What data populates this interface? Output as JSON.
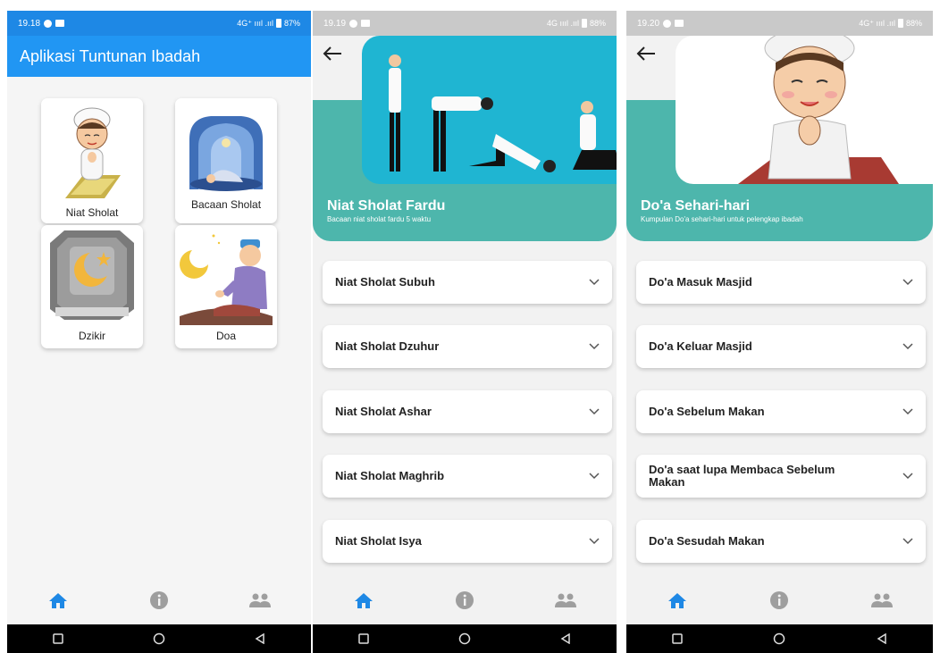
{
  "colors": {
    "primary": "#2196f3",
    "teal": "#4db6ac",
    "nav_active": "#1e88e5",
    "nav_inactive": "#9e9e9e"
  },
  "screen1": {
    "status": {
      "time": "19.18",
      "signal": "4G⁺ ıııl .ııl",
      "battery": "87%"
    },
    "appbar_title": "Aplikasi Tuntunan Ibadah",
    "cards": [
      {
        "label": "Niat Sholat",
        "icon": "praying-boy-icon"
      },
      {
        "label": "Bacaan Sholat",
        "icon": "mosque-prostration-icon"
      },
      {
        "label": "Dzikir",
        "icon": "crescent-star-icon"
      },
      {
        "label": "Doa",
        "icon": "praying-man-icon"
      }
    ]
  },
  "screen2": {
    "status": {
      "time": "19.19",
      "signal": "4G ıııl .ııl",
      "battery": "88%"
    },
    "hero_title": "Niat Sholat Fardu",
    "hero_subtitle": "Bacaan niat sholat fardu 5 waktu",
    "items": [
      "Niat Sholat Subuh",
      "Niat Sholat Dzuhur",
      "Niat Sholat Ashar",
      "Niat Sholat Maghrib",
      "Niat Sholat Isya"
    ]
  },
  "screen3": {
    "status": {
      "time": "19.20",
      "signal": "4G⁺ ıııl .ııl",
      "battery": "88%"
    },
    "hero_title": "Do'a Sehari-hari",
    "hero_subtitle": "Kumpulan Do'a sehari-hari untuk pelengkap ibadah",
    "items": [
      "Do'a Masuk Masjid",
      "Do'a Keluar Masjid",
      "Do'a Sebelum Makan",
      "Do'a saat lupa Membaca Sebelum Makan",
      "Do'a Sesudah Makan"
    ]
  },
  "bottom_nav": [
    "home-icon",
    "info-icon",
    "people-icon"
  ]
}
